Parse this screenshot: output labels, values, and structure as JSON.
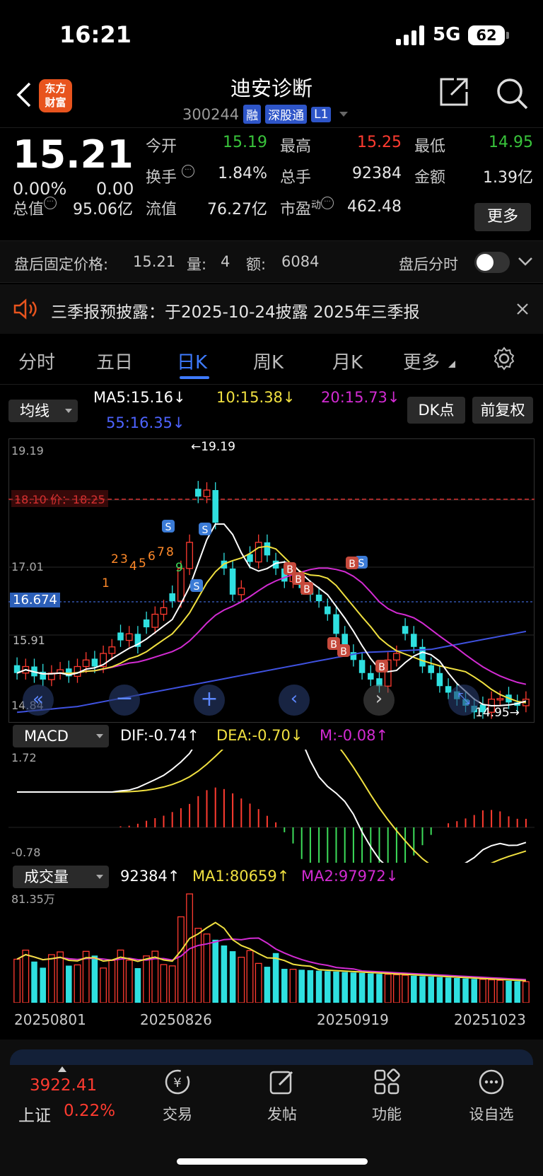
{
  "status": {
    "time": "16:21",
    "network": "5G",
    "battery": "62"
  },
  "header": {
    "title": "迪安诊断",
    "code": "300244",
    "tags": [
      "融",
      "深股通",
      "L1"
    ],
    "logo_text": "东方财富"
  },
  "quote": {
    "price": "15.21",
    "pct": "0.00%",
    "change": "0.00",
    "rows": [
      {
        "l1": "今开",
        "v1": "15.19",
        "l2": "最高",
        "v2": "15.25",
        "l3": "最低",
        "v3": "14.95"
      },
      {
        "l1": "换手",
        "v1": "1.84%",
        "l2": "总手",
        "v2": "92384",
        "l3": "金额",
        "v3": "1.39亿"
      },
      {
        "l1": "总值",
        "v1": "95.06亿",
        "l2": "流值",
        "v2": "76.27亿",
        "l3": "市盈",
        "l3sup": "动",
        "v3": "462.48"
      }
    ],
    "more": "更多"
  },
  "after_hours": {
    "label": "盘后固定价格:",
    "price": "15.21",
    "vol_label": "量:",
    "vol": "4",
    "amt_label": "额:",
    "amt": "6084",
    "switch_label": "盘后分时"
  },
  "notice": {
    "text": "三季报预披露：于2025-10-24披露 2025年三季报"
  },
  "tabs": [
    "分时",
    "五日",
    "日K",
    "周K",
    "月K",
    "更多"
  ],
  "active_tab": "日K",
  "kline": {
    "ma_select": "均线",
    "ma5": "MA5:15.16",
    "ma10": "10:15.38",
    "ma20": "20:15.73",
    "ma55": "55:16.35",
    "dk": "DK点",
    "fq": "前复权",
    "y_top": "19.19",
    "y_mid": "17.01",
    "y_bot": "14.84",
    "cur_price": "16.674",
    "ref_label": "18.10",
    "ref_line": "价：18.25",
    "ref_overlap": "15.91",
    "high_mark": "←19.19",
    "low_mark": "14.95→",
    "markers": [
      "1",
      "2",
      "3",
      "4",
      "5",
      "6",
      "7",
      "8",
      "9"
    ],
    "sell": "S",
    "buy": "B"
  },
  "macd": {
    "select": "MACD",
    "dif": "DIF:-0.74",
    "dea": "DEA:-0.70",
    "m": "M:-0.08",
    "top": "1.72",
    "bot": "-0.78"
  },
  "volume": {
    "select": "成交量",
    "val": "92384",
    "ma1": "MA1:80659",
    "ma2": "MA2:97972",
    "top": "81.35万",
    "dates": [
      "20250801",
      "20250826",
      "20250919",
      "20251023"
    ]
  },
  "bottom": {
    "index_val": "3922.41",
    "index_name": "上证",
    "index_pct": "0.22%",
    "nav": [
      "交易",
      "发帖",
      "功能",
      "设自选"
    ]
  },
  "colors": {
    "up": "#ff3b30",
    "down": "#2fe0e0",
    "ma5": "#ffffff",
    "ma10": "#f0e040",
    "ma20": "#d22bd2",
    "ma55": "#3f52e0"
  }
}
